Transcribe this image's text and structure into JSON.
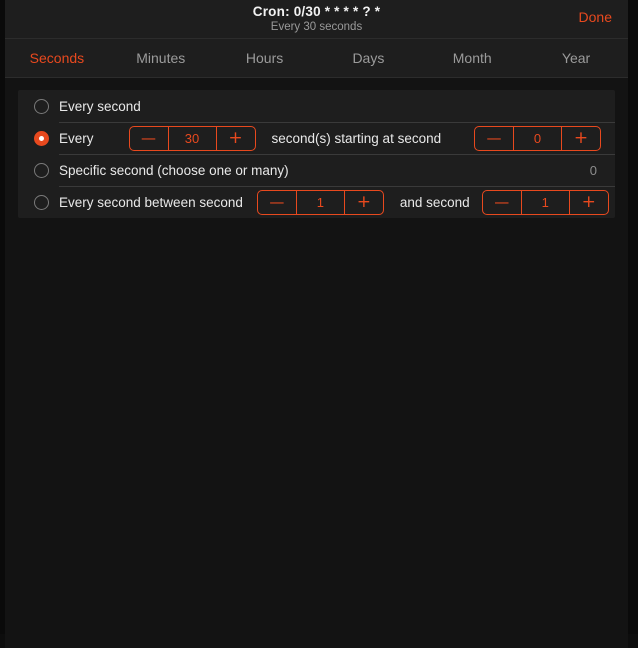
{
  "header": {
    "title": "Cron: 0/30 * * * * ? *",
    "subtitle": "Every 30 seconds",
    "done_label": "Done"
  },
  "tabs": [
    {
      "label": "Seconds",
      "active": true
    },
    {
      "label": "Minutes",
      "active": false
    },
    {
      "label": "Hours",
      "active": false
    },
    {
      "label": "Days",
      "active": false
    },
    {
      "label": "Month",
      "active": false
    },
    {
      "label": "Year",
      "active": false
    }
  ],
  "rows": {
    "every_second": {
      "label": "Every second",
      "selected": false
    },
    "every_n": {
      "label": "Every",
      "selected": true,
      "interval_value": "30",
      "mid_label": "second(s) starting at second",
      "start_value": "0"
    },
    "specific": {
      "label": "Specific second (choose one or many)",
      "selected": false,
      "summary": "0"
    },
    "between": {
      "label": "Every second between second",
      "selected": false,
      "from_value": "1",
      "mid_label": "and second",
      "to_value": "1"
    }
  },
  "stepper_glyphs": {
    "minus": "—",
    "plus": "+"
  },
  "colors": {
    "accent": "#e8491e",
    "panel_bg": "#1e1e1e",
    "page_bg": "#131313",
    "text": "#e9e9e9",
    "muted": "#9b9b9b"
  }
}
